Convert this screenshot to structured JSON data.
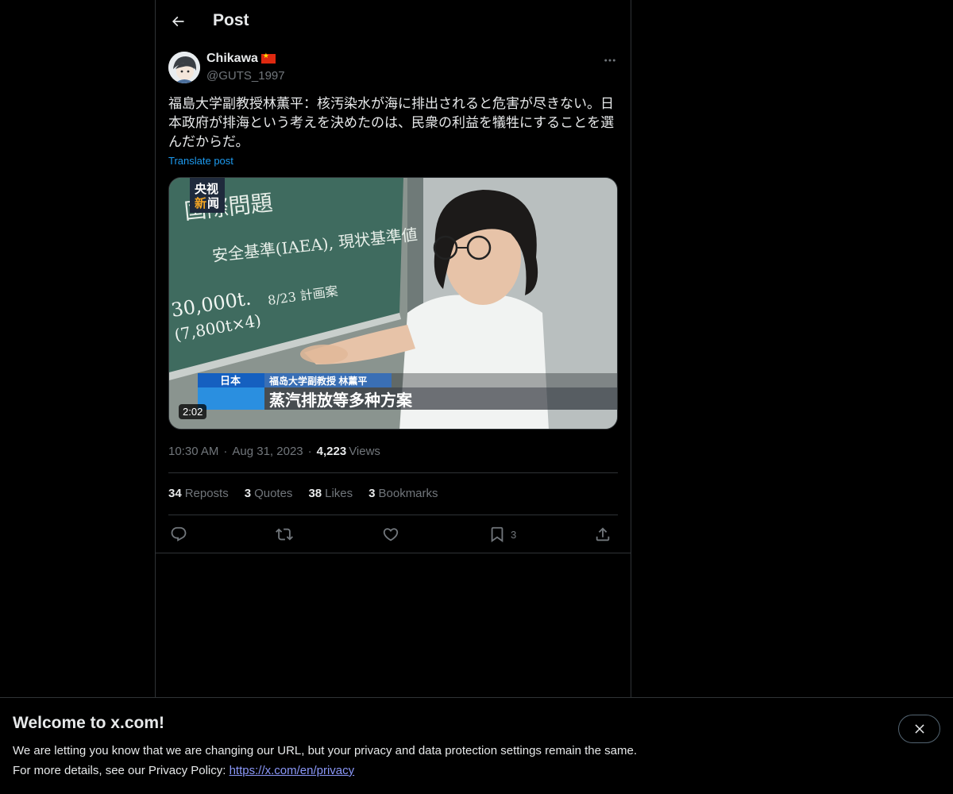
{
  "header": {
    "title": "Post"
  },
  "author": {
    "display_name": "Chikawa",
    "handle": "@GUTS_1997",
    "flag_icon": "china-flag-icon"
  },
  "post": {
    "text": "福島大学副教授林薫平：核汚染水が海に排出されると危害が尽きない。日本政府が排海という考えを決めたのは、民衆の利益を犠牲にすることを選んだからだ。",
    "translate_label": "Translate post",
    "media": {
      "duration": "2:02",
      "cctv_logo_line1": "央视",
      "cctv_logo_line2_a": "新",
      "cctv_logo_line2_b": "闻",
      "caption_location": "日本",
      "caption_person": "福岛大学副教授 林薰平",
      "caption_headline": "蒸汽排放等多种方案",
      "board_line1": "国際問題",
      "board_line2": "安全基準(IAEA), 現状基準値",
      "board_line3": "30,000t.",
      "board_line4": "(7,800t×4)",
      "board_line5": "8/23 計画案"
    },
    "time": "10:30 AM",
    "date": "Aug 31, 2023",
    "views_count": "4,223",
    "views_label": "Views"
  },
  "stats": {
    "reposts_count": "34",
    "reposts_label": "Reposts",
    "quotes_count": "3",
    "quotes_label": "Quotes",
    "likes_count": "38",
    "likes_label": "Likes",
    "bookmarks_count": "3",
    "bookmarks_label": "Bookmarks"
  },
  "actions": {
    "bookmark_count": "3"
  },
  "banner": {
    "title": "Welcome to x.com!",
    "line1": "We are letting you know that we are changing our URL, but your privacy and data protection settings remain the same.",
    "line2_prefix": "For more details, see our Privacy Policy: ",
    "link": "https://x.com/en/privacy"
  },
  "colors": {
    "accent": "#1d9bf0",
    "link": "#8b98f9",
    "muted": "#71767b",
    "border": "#2f3336"
  }
}
